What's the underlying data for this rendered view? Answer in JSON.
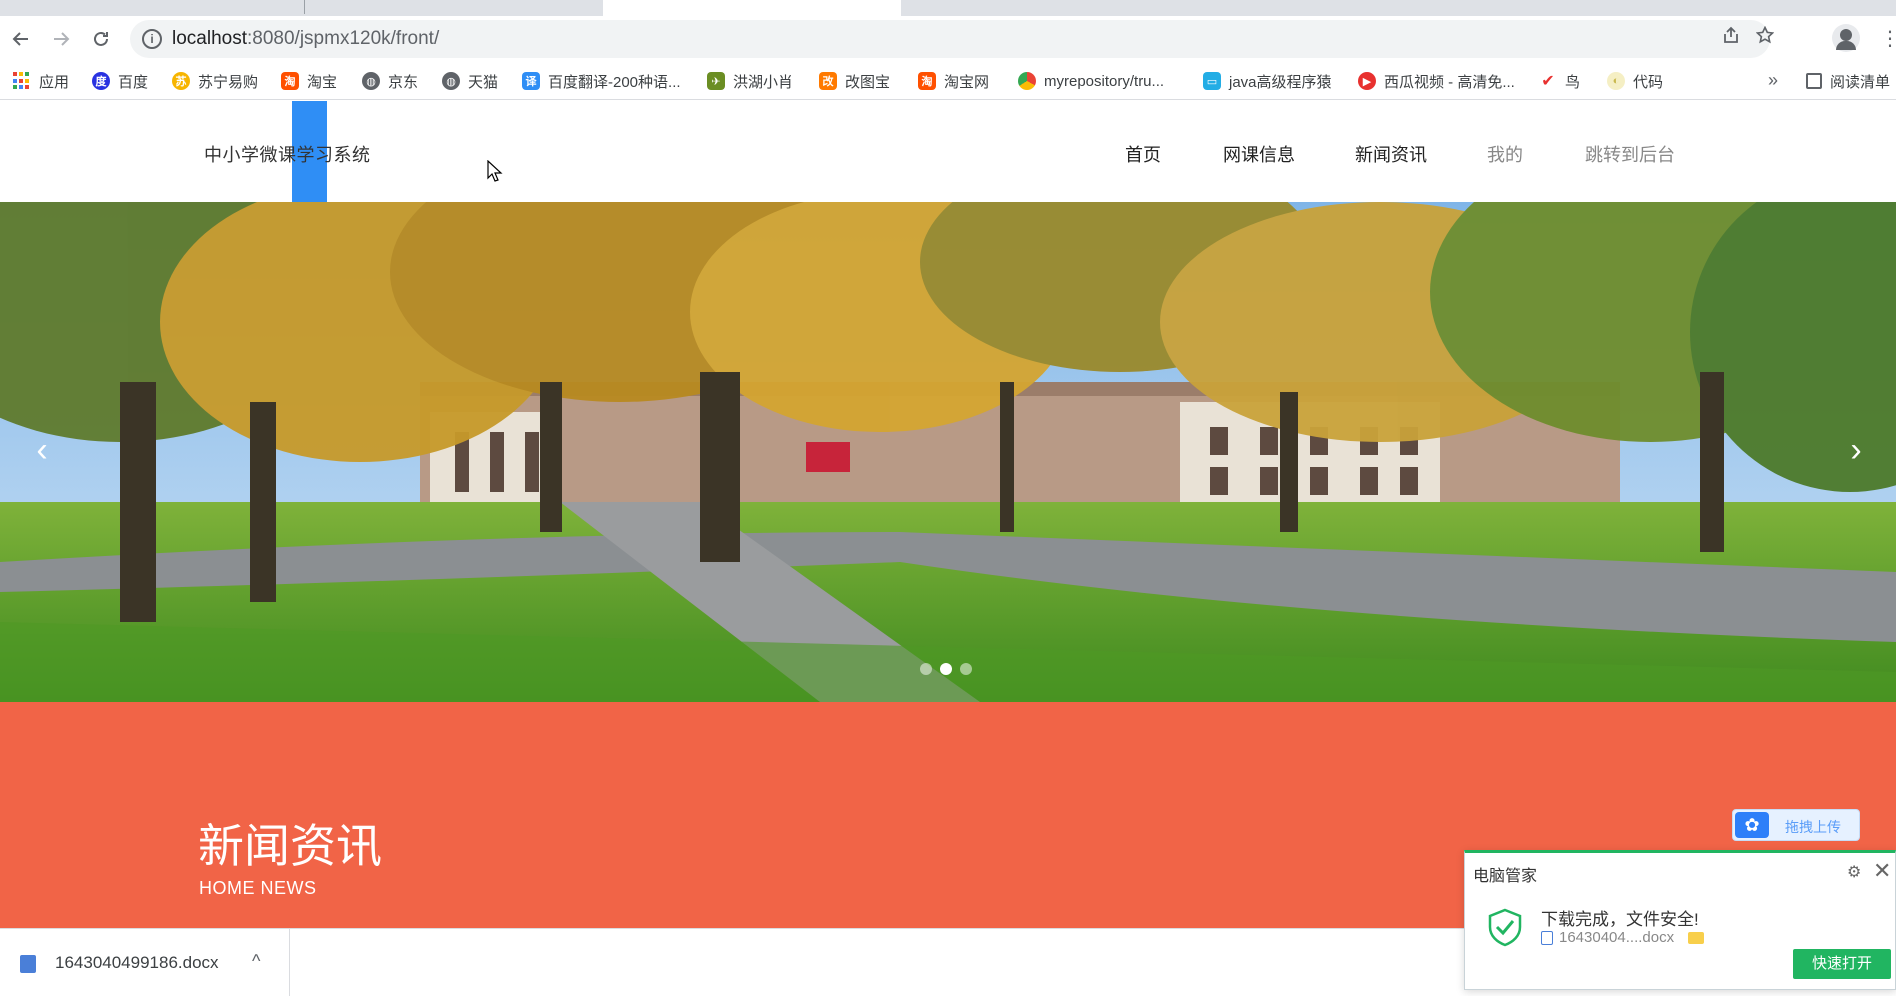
{
  "browser": {
    "tabs": [
      {
        "label": ""
      },
      {
        "label": ""
      },
      {
        "label": ""
      },
      {
        "label": ""
      }
    ],
    "url_host": "localhost",
    "url_rest": ":8080/jspmx120k/front/",
    "bookmarks": [
      {
        "label": "应用",
        "icon": "apps-icon"
      },
      {
        "label": "百度",
        "icon": "baidu-icon",
        "color": "#2932e1"
      },
      {
        "label": "苏宁易购",
        "icon": "suning-icon",
        "color": "#f7b500"
      },
      {
        "label": "淘宝",
        "icon": "taobao-icon",
        "color": "#ff5000"
      },
      {
        "label": "京东",
        "icon": "globe-icon",
        "color": "#5f6368"
      },
      {
        "label": "天猫",
        "icon": "globe-icon",
        "color": "#5f6368"
      },
      {
        "label": "百度翻译-200种语...",
        "icon": "baidu-translate-icon",
        "color": "#2f8ef5"
      },
      {
        "label": "洪湖小肖",
        "icon": "bird-icon",
        "color": "#6b8e23"
      },
      {
        "label": "改图宝",
        "icon": "gaitubao-icon",
        "color": "#ff7a00"
      },
      {
        "label": "淘宝网",
        "icon": "taobao-icon",
        "color": "#ff5000"
      },
      {
        "label": "myrepository/tru...",
        "icon": "chrome-icon",
        "color": "#34a853"
      },
      {
        "label": "java高级程序猿",
        "icon": "bilibili-icon",
        "color": "#23ade5"
      },
      {
        "label": "西瓜视频 - 高清免...",
        "icon": "xigua-icon",
        "color": "#e8312f"
      },
      {
        "label": "鸟",
        "icon": "bird-red-icon",
        "color": "#e8312f"
      },
      {
        "label": "代码",
        "icon": "moon-icon",
        "color": "#e7d77b"
      }
    ],
    "bookmarks_more": "»",
    "reading_list": "阅读清单"
  },
  "site": {
    "title": "中小学微课学习系统",
    "nav": [
      "首页",
      "网课信息",
      "新闻资讯",
      "我的",
      "跳转到后台"
    ],
    "carousel": {
      "prev": "‹",
      "next": "›",
      "slides": 3,
      "active_slide": 2
    },
    "news_section": {
      "title": "新闻资讯",
      "subtitle": "HOME NEWS"
    }
  },
  "upload_widget": {
    "label": "拖拽上传"
  },
  "download_bar": {
    "filename": "1643040499186.docx",
    "chevron": "^"
  },
  "pc_manager_popup": {
    "title": "电脑管家",
    "message": "下载完成，文件安全!",
    "file": "16430404....docx",
    "button": "快速打开"
  }
}
